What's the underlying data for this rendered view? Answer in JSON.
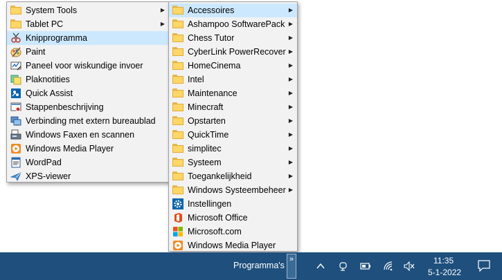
{
  "left_menu": {
    "items": [
      {
        "label": "System Tools",
        "icon": "folder-icon",
        "submenu": true
      },
      {
        "label": "Tablet PC",
        "icon": "folder-icon",
        "submenu": true
      },
      {
        "label": "Knipprogramma",
        "icon": "snipping-tool-icon",
        "submenu": false,
        "highlighted": true
      },
      {
        "label": "Paint",
        "icon": "paint-icon",
        "submenu": false
      },
      {
        "label": "Paneel voor wiskundige invoer",
        "icon": "math-input-icon",
        "submenu": false
      },
      {
        "label": "Plaknotities",
        "icon": "sticky-notes-icon",
        "submenu": false
      },
      {
        "label": "Quick Assist",
        "icon": "quick-assist-icon",
        "submenu": false
      },
      {
        "label": "Stappenbeschrijving",
        "icon": "steps-recorder-icon",
        "submenu": false
      },
      {
        "label": "Verbinding met extern bureaublad",
        "icon": "remote-desktop-icon",
        "submenu": false
      },
      {
        "label": "Windows Faxen en scannen",
        "icon": "fax-scan-icon",
        "submenu": false
      },
      {
        "label": "Windows Media Player",
        "icon": "media-player-icon",
        "submenu": false
      },
      {
        "label": "WordPad",
        "icon": "wordpad-icon",
        "submenu": false
      },
      {
        "label": "XPS-viewer",
        "icon": "xps-viewer-icon",
        "submenu": false
      }
    ]
  },
  "right_menu": {
    "items": [
      {
        "label": "Accessoires",
        "icon": "folder-icon",
        "submenu": true,
        "highlighted": true
      },
      {
        "label": "Ashampoo SoftwarePack",
        "icon": "folder-icon",
        "submenu": true
      },
      {
        "label": "Chess Tutor",
        "icon": "folder-icon",
        "submenu": true
      },
      {
        "label": "CyberLink PowerRecover",
        "icon": "folder-icon",
        "submenu": true
      },
      {
        "label": "HomeCinema",
        "icon": "folder-icon",
        "submenu": true
      },
      {
        "label": "Intel",
        "icon": "folder-icon",
        "submenu": true
      },
      {
        "label": "Maintenance",
        "icon": "folder-icon",
        "submenu": true
      },
      {
        "label": "Minecraft",
        "icon": "folder-icon",
        "submenu": true
      },
      {
        "label": "Opstarten",
        "icon": "folder-icon",
        "submenu": true
      },
      {
        "label": "QuickTime",
        "icon": "folder-icon",
        "submenu": true
      },
      {
        "label": "simplitec",
        "icon": "folder-icon",
        "submenu": true
      },
      {
        "label": "Systeem",
        "icon": "folder-icon",
        "submenu": true
      },
      {
        "label": "Toegankelijkheid",
        "icon": "folder-icon",
        "submenu": true
      },
      {
        "label": "Windows Systeembeheer",
        "icon": "folder-icon",
        "submenu": true
      },
      {
        "label": "Instellingen",
        "icon": "settings-gear-icon",
        "submenu": false
      },
      {
        "label": "Microsoft Office",
        "icon": "office-icon",
        "submenu": false
      },
      {
        "label": "Microsoft.com",
        "icon": "microsoft-logo-icon",
        "submenu": false
      },
      {
        "label": "Windows Media Player",
        "icon": "media-player-icon",
        "submenu": false
      }
    ]
  },
  "taskbar": {
    "toolbar_label": "Programma's",
    "chevron": "»",
    "time": "11:35",
    "date": "5-1-2022",
    "tray_icons": [
      "show-hidden-icons-icon",
      "meet-now-icon",
      "battery-icon",
      "wifi-icon",
      "volume-muted-icon",
      "action-center-icon"
    ]
  },
  "colors": {
    "highlight": "#cce8ff",
    "menu_bg": "#f2f2f2",
    "taskbar_bg": "#1e4f7d"
  }
}
